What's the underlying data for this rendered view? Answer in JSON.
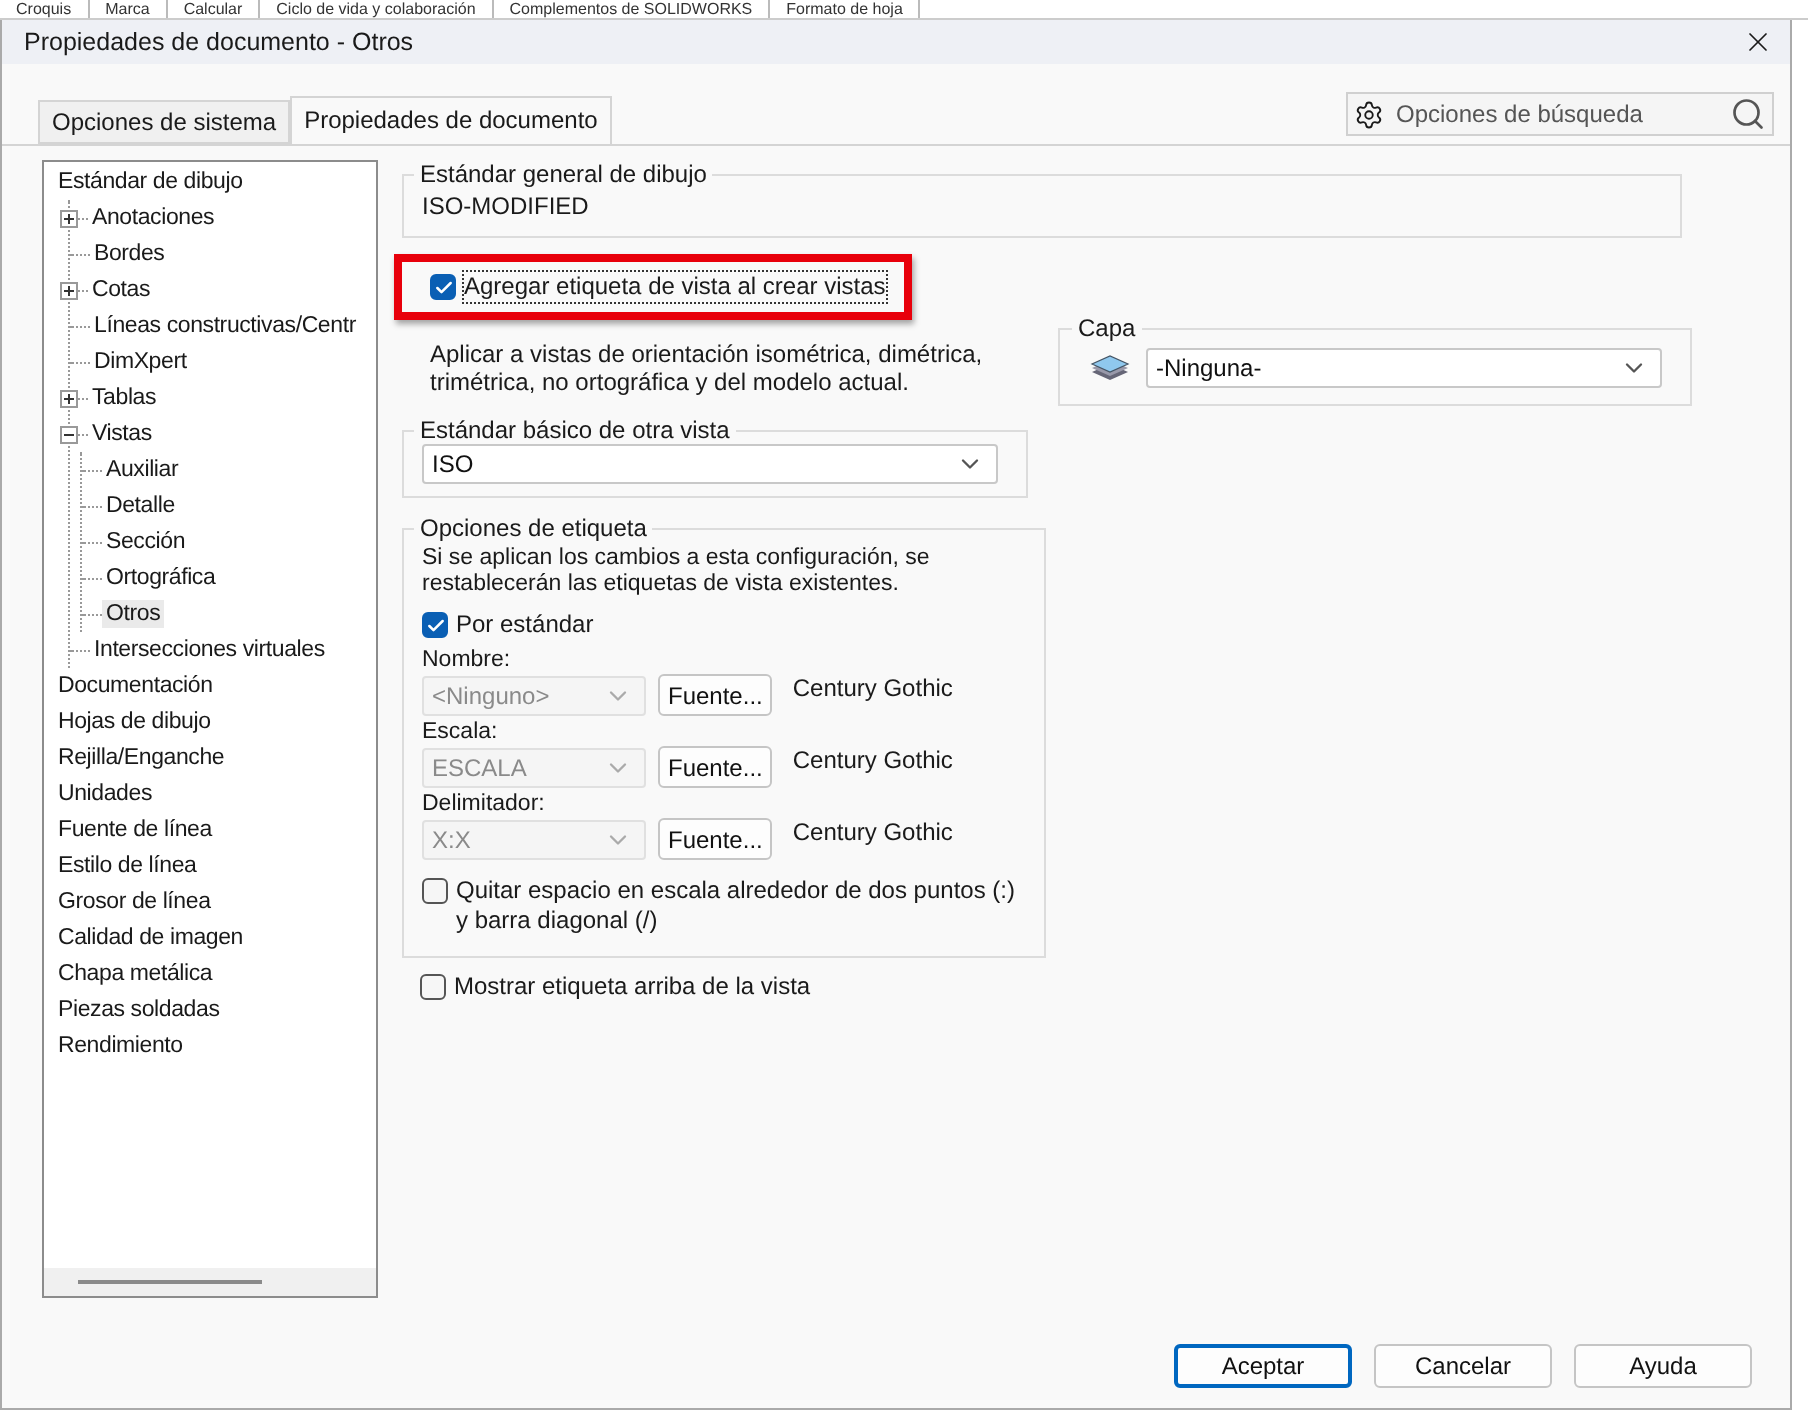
{
  "background_tabs": [
    {
      "label": "Croquis"
    },
    {
      "label": "Marca"
    },
    {
      "label": "Calcular"
    },
    {
      "label": "Ciclo de vida y colaboración"
    },
    {
      "label": "Complementos de SOLIDWORKS"
    },
    {
      "label": "Formato de hoja"
    }
  ],
  "window": {
    "title": "Propiedades de documento - Otros"
  },
  "tabs": [
    {
      "label": "Opciones de sistema",
      "selected": false
    },
    {
      "label": "Propiedades de documento",
      "selected": true
    }
  ],
  "search": {
    "placeholder": "Opciones de búsqueda"
  },
  "tree": {
    "items": [
      {
        "label": "Estándar de dibujo",
        "selected": false,
        "children": [
          {
            "label": "Anotaciones",
            "selected": false,
            "expanded": false
          },
          {
            "label": "Bordes",
            "selected": false
          },
          {
            "label": "Cotas",
            "selected": false,
            "expanded": false
          },
          {
            "label": "Líneas constructivas/Centr",
            "selected": false
          },
          {
            "label": "DimXpert",
            "selected": false
          },
          {
            "label": "Tablas",
            "selected": false,
            "expanded": false
          },
          {
            "label": "Vistas",
            "selected": false,
            "expanded": true,
            "children": [
              {
                "label": "Auxiliar",
                "selected": false
              },
              {
                "label": "Detalle",
                "selected": false
              },
              {
                "label": "Sección",
                "selected": false
              },
              {
                "label": "Ortográfica",
                "selected": false
              },
              {
                "label": "Otros",
                "selected": true
              }
            ]
          },
          {
            "label": "Intersecciones virtuales",
            "selected": false
          }
        ]
      },
      {
        "label": "Documentación",
        "selected": false
      },
      {
        "label": "Hojas de dibujo",
        "selected": false
      },
      {
        "label": "Rejilla/Enganche",
        "selected": false
      },
      {
        "label": "Unidades",
        "selected": false
      },
      {
        "label": "Fuente de línea",
        "selected": false
      },
      {
        "label": "Estilo de línea",
        "selected": false
      },
      {
        "label": "Grosor de línea",
        "selected": false
      },
      {
        "label": "Calidad de imagen",
        "selected": false
      },
      {
        "label": "Chapa metálica",
        "selected": false
      },
      {
        "label": "Piezas soldadas",
        "selected": false
      },
      {
        "label": "Rendimiento",
        "selected": false
      }
    ]
  },
  "general_standard": {
    "title": "Estándar general de dibujo",
    "value": "ISO-MODIFIED"
  },
  "add_view_label": {
    "label": "Agregar etiqueta de vista al crear vistas",
    "checked": true,
    "highlighted": true
  },
  "description": "Aplicar a vistas de orientación isométrica, dimétrica, trimétrica, no ortográfica y del modelo actual.",
  "layer": {
    "title": "Capa",
    "value": "-Ninguna-"
  },
  "other_view_standard": {
    "title": "Estándar básico de otra vista",
    "value": "ISO"
  },
  "label_options": {
    "title": "Opciones de etiqueta",
    "note": "Si se aplican los cambios a esta configuración, se restablecerán las etiquetas de vista existentes.",
    "by_standard": {
      "label": "Por estándar",
      "checked": true
    },
    "fields": [
      {
        "label": "Nombre:",
        "value": "<Ninguno>",
        "disabled": true,
        "button": "Fuente...",
        "font": "Century Gothic"
      },
      {
        "label": "Escala:",
        "value": "ESCALA",
        "disabled": true,
        "button": "Fuente...",
        "font": "Century Gothic"
      },
      {
        "label": "Delimitador:",
        "value": "X:X",
        "disabled": true,
        "button": "Fuente...",
        "font": "Century Gothic"
      }
    ],
    "remove_space": {
      "label": "Quitar espacio en escala alrededor de dos puntos (:) y barra diagonal (/)",
      "checked": false
    }
  },
  "show_above": {
    "label": "Mostrar etiqueta arriba de la vista",
    "checked": false
  },
  "buttons": [
    {
      "label": "Aceptar",
      "default": true
    },
    {
      "label": "Cancelar",
      "default": false
    },
    {
      "label": "Ayuda",
      "default": false
    }
  ]
}
